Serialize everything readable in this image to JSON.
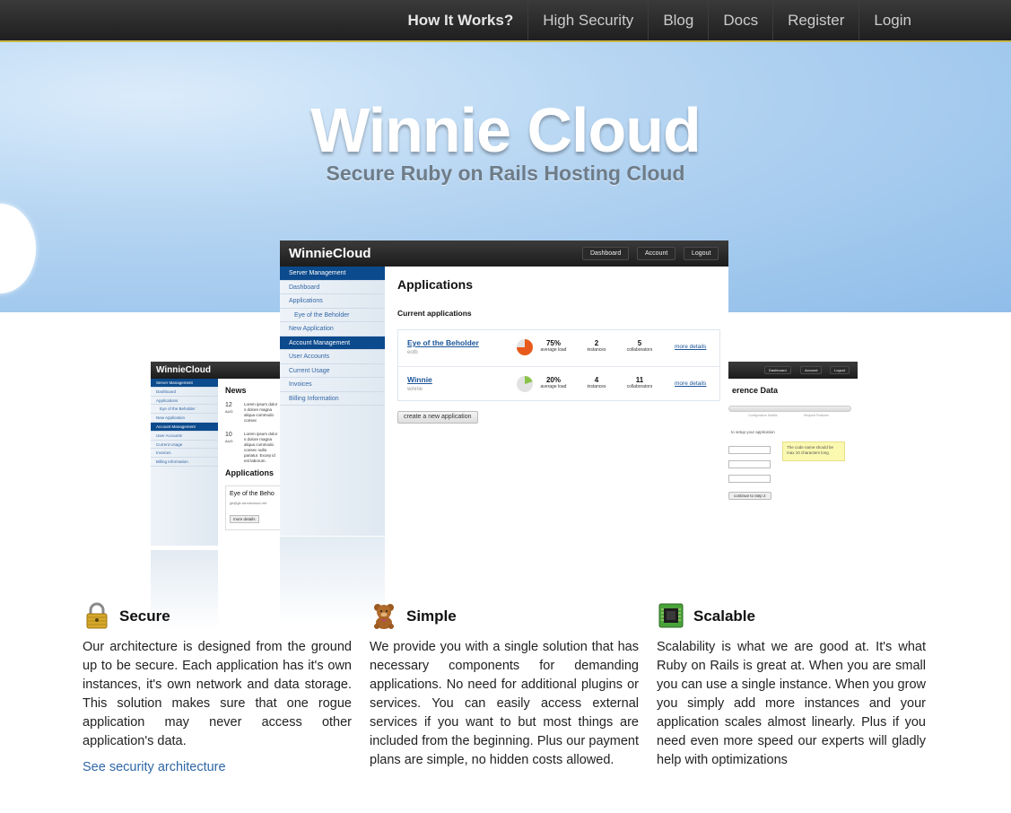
{
  "nav": {
    "items": [
      "How It Works?",
      "High Security",
      "Blog",
      "Docs",
      "Register",
      "Login"
    ]
  },
  "hero": {
    "title": "Winnie Cloud",
    "subtitle": "Secure Ruby on Rails Hosting Cloud"
  },
  "main_mock": {
    "logo": "WinnieCloud",
    "header_buttons": [
      "Dashboard",
      "Account",
      "Logout"
    ],
    "sidebar": {
      "server_header": "Server Management",
      "dashboard": "Dashboard",
      "applications": "Applications",
      "eye_app": "Eye of the Beholder",
      "new_app": "New Application",
      "account_header": "Account Management",
      "user_accounts": "User Accounts",
      "current_usage": "Current Usage",
      "invoices": "Invoices",
      "billing": "Billing Information"
    },
    "title": "Applications",
    "subtitle": "Current applications",
    "apps": [
      {
        "name": "Eye of the Beholder",
        "sub": "eotb",
        "load": "75%",
        "load_label": "average load",
        "instances": "2",
        "instances_label": "instances",
        "collaborators": "5",
        "collaborators_label": "collaborators",
        "more": "more details",
        "load_fraction": 0.75
      },
      {
        "name": "Winnie",
        "sub": "winnie",
        "load": "20%",
        "load_label": "average load",
        "instances": "4",
        "instances_label": "instances",
        "collaborators": "11",
        "collaborators_label": "collaborators",
        "more": "more details",
        "load_fraction": 0.2
      }
    ],
    "create_button": "create a new application"
  },
  "left_mock": {
    "logo": "WinnieCloud",
    "sidebar": {
      "server_header": "Server Management",
      "dashboard": "Dashboard",
      "applications": "Applications",
      "eye_app": "Eye of the Beholder",
      "new_app": "New Application",
      "account_header": "Account Management",
      "user_accounts": "User Accounts",
      "current_usage": "Current Usage",
      "invoices": "Invoices",
      "billing": "Billing Information"
    },
    "news_title": "News",
    "news": [
      {
        "day": "12",
        "month": "AUG",
        "text": "Lorem ipsum dolor s dolore magna aliqua commodo consec"
      },
      {
        "day": "10",
        "month": "AUG",
        "text": "Lorem ipsum dolor s dolore magna aliqua commodo consec nulla pariatur. Excep id est laborum."
      }
    ],
    "apps_title": "Applications",
    "app_name": "Eye of the Beho",
    "app_git": "git@git.winniecloud.net",
    "app_button": "more details"
  },
  "right_mock": {
    "header_buttons": [
      "Dashboard",
      "Account",
      "Logout"
    ],
    "title": "erence Data",
    "step_labels": [
      "Configuration Details",
      "Request Features"
    ],
    "label": "to setup your application",
    "note": "The code name should be max 10 characters long",
    "button": "continue to step 2"
  },
  "features": [
    {
      "title": "Secure",
      "icon": "padlock-icon",
      "text": "Our architecture is designed from the ground up to be secure. Each application has it's own instances, it's own network and data storage. This solution makes sure that one rogue application may never access other application's data.",
      "link": "See security architecture"
    },
    {
      "title": "Simple",
      "icon": "teddy-bear-icon",
      "text": "We provide you with a single solution that has necessary components for demanding applications. No need for additional plugins or services. You can easily access external services if you want to but most things are included from the beginning. Plus our payment plans are simple, no hidden costs allowed."
    },
    {
      "title": "Scalable",
      "icon": "chip-icon",
      "text": "Scalability is what we are good at. It's what Ruby on Rails is great at. When you are small you can use a single instance. When you grow you simply add more instances and your application scales almost linearly. Plus if you need even more speed our experts will gladly help with optimizations"
    }
  ],
  "colors": {
    "nav_bg": "#262626",
    "hero_blue": "#8fbde9",
    "link_blue": "#2f67a6",
    "sidebar_header": "#0b4a8c"
  }
}
